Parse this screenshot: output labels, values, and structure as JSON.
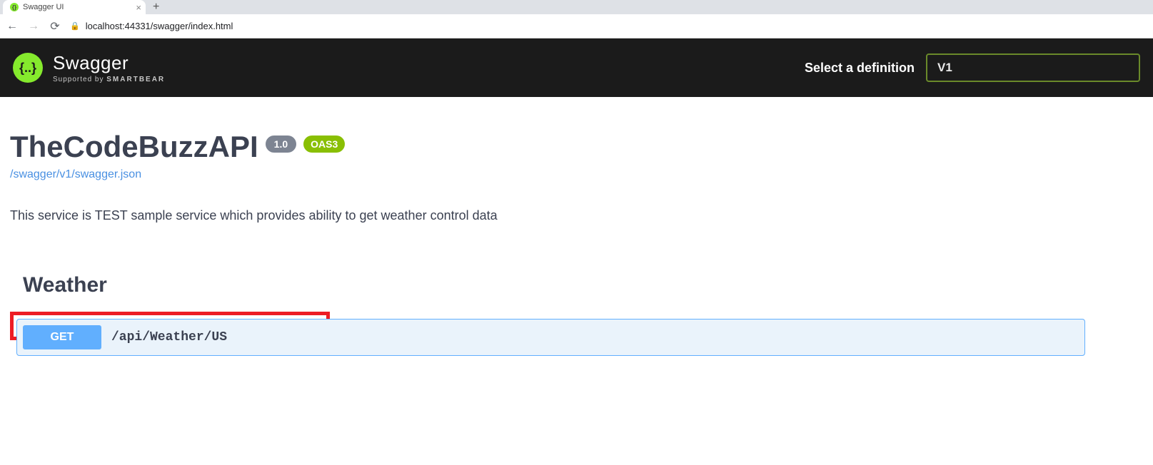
{
  "browser": {
    "tab_title": "Swagger UI",
    "url": "localhost:44331/swagger/index.html"
  },
  "header": {
    "brand": "Swagger",
    "supported_prefix": "Supported by ",
    "supported_by": "SMARTBEAR",
    "definition_label": "Select a definition",
    "definition_value": "V1"
  },
  "api": {
    "title": "TheCodeBuzzAPI",
    "version": "1.0",
    "oas": "OAS3",
    "spec_link": "/swagger/v1/swagger.json",
    "description": "This service is TEST sample service which provides ability to get weather control data"
  },
  "section": {
    "name": "Weather"
  },
  "operation": {
    "method": "GET",
    "path": "/api/Weather/US"
  }
}
